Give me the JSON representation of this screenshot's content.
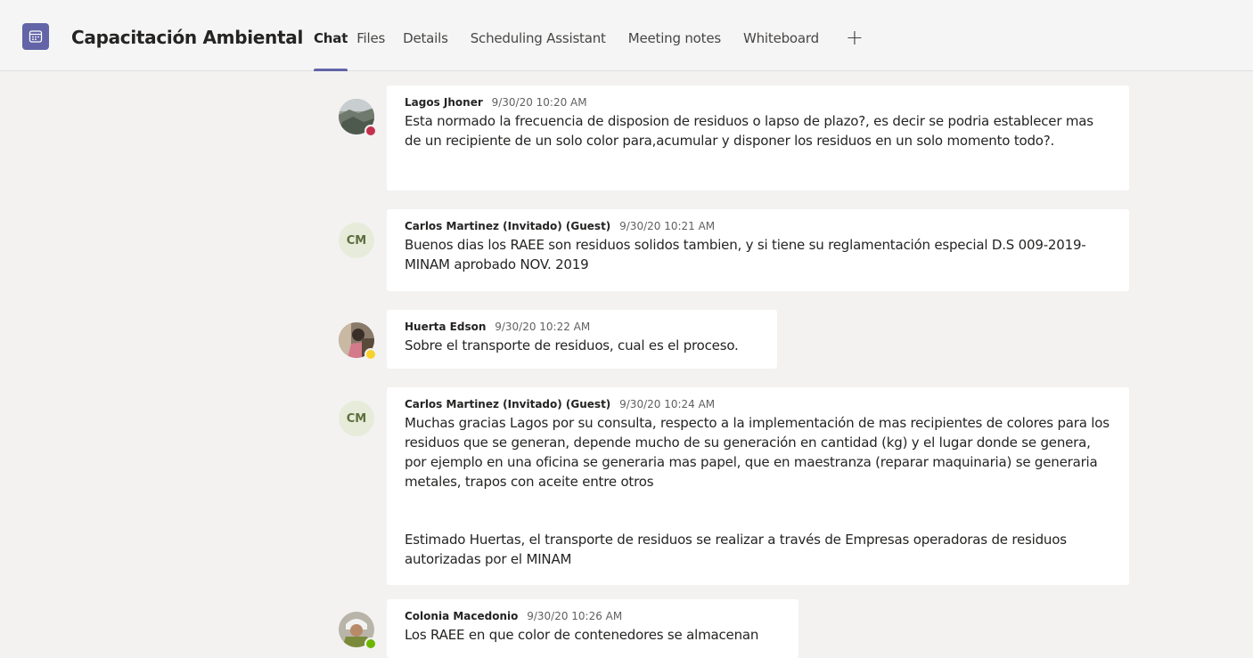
{
  "header": {
    "title": "Capacitación Ambiental",
    "icon": "calendar-icon",
    "tabs": [
      {
        "label": "Chat",
        "active": true
      },
      {
        "label": "Files"
      },
      {
        "label": "Details"
      },
      {
        "label": "Scheduling Assistant"
      },
      {
        "label": "Meeting notes"
      },
      {
        "label": "Whiteboard"
      }
    ],
    "add_tab": "+"
  },
  "colors": {
    "accent": "#6264a7",
    "status_busy": "#c4314b",
    "status_away": "#f8d22a",
    "status_available": "#6bb700"
  },
  "messages": [
    {
      "author": "Lagos Jhoner",
      "time": "9/30/20 10:20 AM",
      "avatar": "photo",
      "status": "busy",
      "text": "Esta normado la frecuencia de disposion de residuos o lapso de plazo?, es decir se podria establecer mas de un recipiente de un solo color para,acumular y disponer los residuos en un solo momento todo?."
    },
    {
      "author": "Carlos Martinez (Invitado) (Guest)",
      "time": "9/30/20 10:21 AM",
      "avatar": "CM",
      "text": "Buenos dias los RAEE son residuos solidos tambien, y si tiene su reglamentación especial D.S 009-2019-MINAM aprobado NOV. 2019"
    },
    {
      "author": "Huerta Edson",
      "time": "9/30/20 10:22 AM",
      "avatar": "photo",
      "status": "away",
      "text": "Sobre el transporte de residuos, cual es el proceso."
    },
    {
      "author": "Carlos Martinez (Invitado) (Guest)",
      "time": "9/30/20 10:24 AM",
      "avatar": "CM",
      "text": "Muchas gracias Lagos por su consulta, respecto a la implementación de mas recipientes de colores para los residuos que se generan, depende mucho de su generación en cantidad (kg) y el lugar donde se genera, por ejemplo en una oficina se generaria mas papel, que en maestranza (reparar maquinaria) se generaria metales, trapos con aceite entre otros",
      "followup": "Estimado Huertas, el transporte de residuos se realizar a través de Empresas operadoras de residuos autorizadas por el MINAM"
    },
    {
      "author": "Colonia Macedonio",
      "time": "9/30/20 10:26 AM",
      "avatar": "photo",
      "status": "available",
      "text": "Los RAEE en que color de contenedores se almacenan"
    }
  ]
}
